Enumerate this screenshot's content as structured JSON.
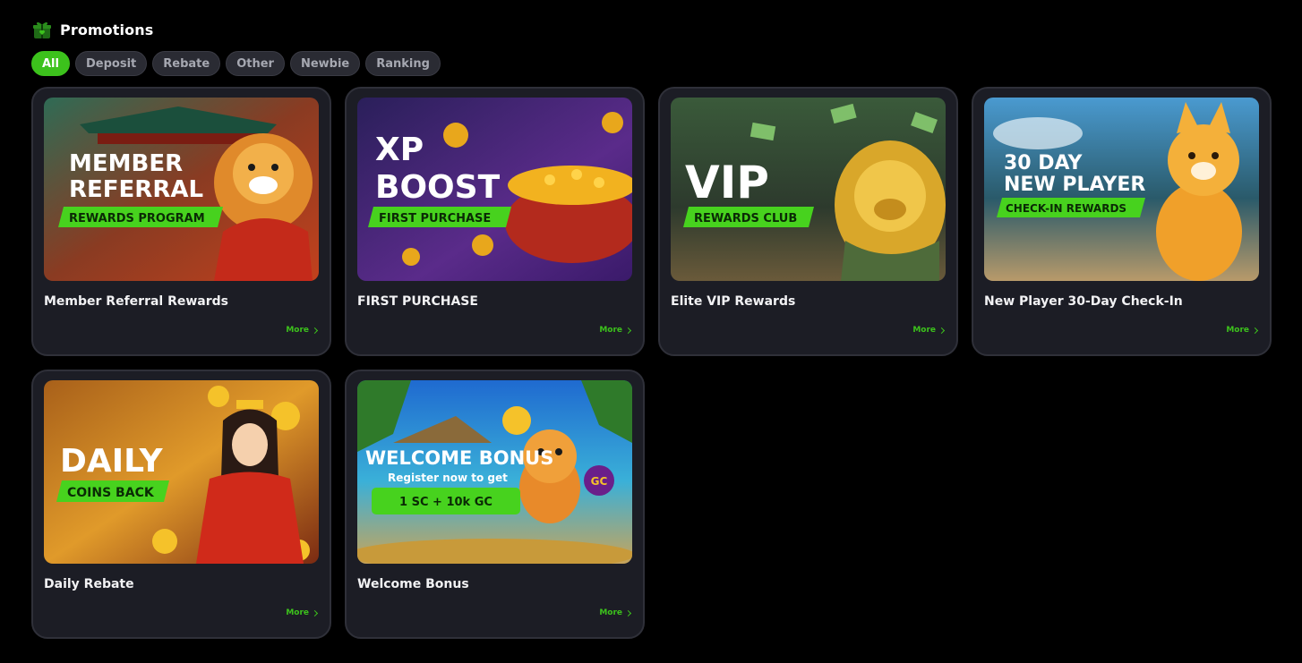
{
  "header": {
    "title": "Promotions",
    "icon": "gift-icon"
  },
  "filters": [
    {
      "label": "All",
      "active": true
    },
    {
      "label": "Deposit",
      "active": false
    },
    {
      "label": "Rebate",
      "active": false
    },
    {
      "label": "Other",
      "active": false
    },
    {
      "label": "Newbie",
      "active": false
    },
    {
      "label": "Ranking",
      "active": false
    }
  ],
  "colors": {
    "accent": "#3cc21c",
    "card_bg": "#1c1d25",
    "page_bg": "#000000"
  },
  "cards": [
    {
      "title": "Member Referral Rewards",
      "more": "More",
      "banner": {
        "line1": "MEMBER",
        "line2": "REFERRAL",
        "tag": "REWARDS PROGRAM"
      }
    },
    {
      "title": "FIRST PURCHASE",
      "more": "More",
      "banner": {
        "line1": "XP",
        "line2": "BOOST",
        "tag": "FIRST PURCHASE"
      }
    },
    {
      "title": "Elite VIP Rewards",
      "more": "More",
      "banner": {
        "line1": "VIP",
        "tag": "REWARDS CLUB"
      }
    },
    {
      "title": "New Player 30-Day Check-In",
      "more": "More",
      "banner": {
        "line1": "30 DAY",
        "line2": "NEW PLAYER",
        "tag": "CHECK-IN REWARDS"
      }
    },
    {
      "title": "Daily Rebate",
      "more": "More",
      "banner": {
        "line1": "DAILY",
        "tag": "COINS BACK"
      }
    },
    {
      "title": "Welcome Bonus",
      "more": "More",
      "banner": {
        "line1": "WELCOME BONUS",
        "line2": "Register now to get",
        "tag": "1 SC + 10k GC",
        "coin_badge": "GC"
      }
    }
  ]
}
